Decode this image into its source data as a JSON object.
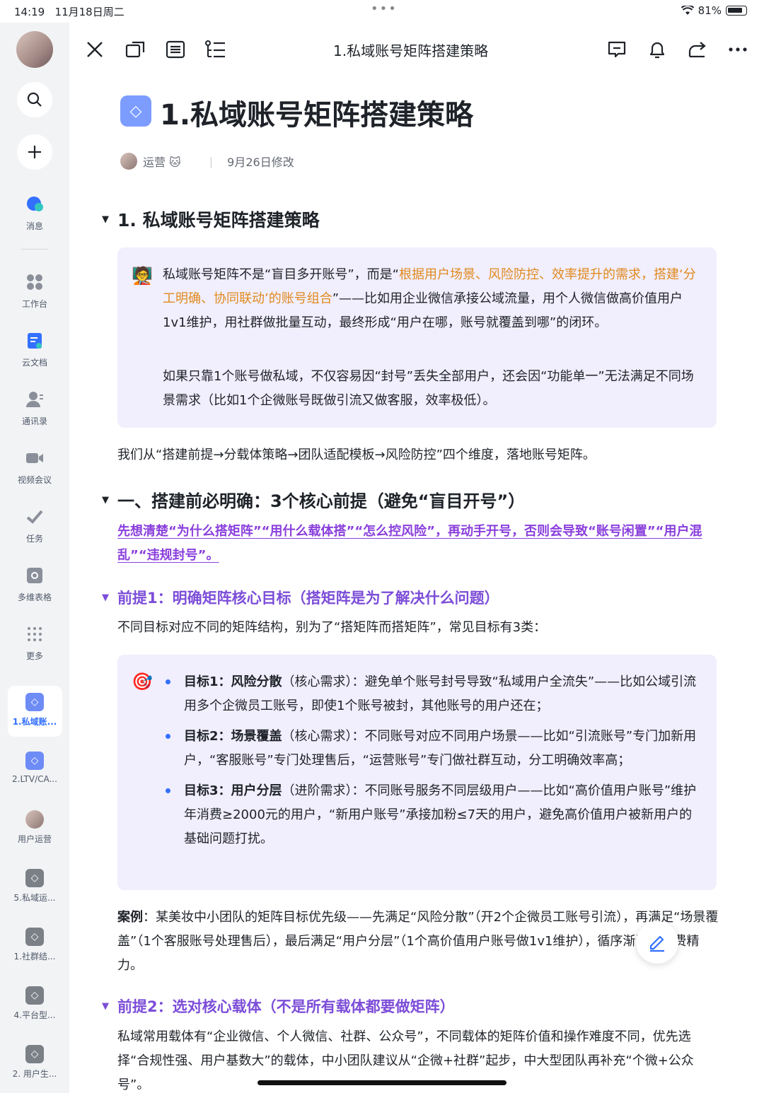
{
  "status": {
    "time": "14:19",
    "date": "11月18日周二",
    "battery": "81%"
  },
  "sidebar": {
    "items": [
      {
        "label": "消息",
        "icon": "chat-bubble-icon"
      },
      {
        "label": "工作台",
        "icon": "grid-icon"
      },
      {
        "label": "云文档",
        "icon": "document-icon"
      },
      {
        "label": "通讯录",
        "icon": "contacts-icon"
      },
      {
        "label": "视频会议",
        "icon": "video-camera-icon"
      },
      {
        "label": "任务",
        "icon": "checkmark-icon"
      },
      {
        "label": "多维表格",
        "icon": "table-icon"
      },
      {
        "label": "更多",
        "icon": "more-dots-icon"
      }
    ],
    "docs": [
      {
        "label": "1.私域账...",
        "active": true
      },
      {
        "label": "2.LTV/CA..."
      },
      {
        "label": "用户运营"
      },
      {
        "label": "5.私域运..."
      },
      {
        "label": "1.社群结..."
      },
      {
        "label": "4.平台型..."
      },
      {
        "label": "2. 用户生..."
      }
    ]
  },
  "toolbar": {
    "title": "1.私域账号矩阵搭建策略"
  },
  "doc": {
    "title": "1.私域账号矩阵搭建策略",
    "author": "运营 🐱",
    "modified": "9月26日修改",
    "h1": "1. 私域账号矩阵搭建策略",
    "callout1": {
      "emoji": "🧑‍🏫",
      "p1_a": "私域账号矩阵不是“盲目多开账号”，而是“",
      "p1_orange": "根据用户场景、风险防控、效率提升的需求，搭建‘分工明确、协同联动’的账号组合",
      "p1_b": "”——比如用企业微信承接公域流量，用个人微信做高价值用户1v1维护，用社群做批量互动，最终形成“用户在哪，账号就覆盖到哪”的闭环。",
      "p2": "如果只靠1个账号做私域，不仅容易因“封号”丢失全部用户，还会因“功能单一”无法满足不同场景需求（比如1个企微账号既做引流又做客服，效率极低）。"
    },
    "intro": "我们从“搭建前提→分载体策略→团队适配模板→风险防控”四个维度，落地账号矩阵。",
    "h1_2": "一、搭建前必明确：3个核心前提（避免“盲目开号”）",
    "purple_note": "先想清楚“为什么搭矩阵”“用什么载体搭”“怎么控风险”，再动手开号，否则会导致“账号闲置”“用户混乱”“违规封号”。",
    "h2_1": "前提1：明确矩阵核心目标（搭矩阵是为了解决什么问题）",
    "p_goal": "不同目标对应不同的矩阵结构，别为了“搭矩阵而搭矩阵”，常见目标有3类：",
    "callout2": {
      "emoji": "🎯",
      "items": [
        {
          "bold": "目标1：风险分散",
          "tag": "（核心需求）",
          "text": "：避免单个账号封号导致“私域用户全流失”——比如公域引流用多个企微员工账号，即使1个账号被封，其他账号的用户还在；"
        },
        {
          "bold": "目标2：场景覆盖",
          "tag": "（核心需求）",
          "text": "：不同账号对应不同用户场景——比如“引流账号”专门加新用户，“客服账号”专门处理售后，“运营账号”专门做社群互动，分工明确效率高；"
        },
        {
          "bold": "目标3：用户分层",
          "tag": "（进阶需求）",
          "text": "：不同账号服务不同层级用户——比如“高价值用户账号”维护年消费≥2000元的用户，“新用户账号”承接加粉≤7天的用户，避免高价值用户被新用户的基础问题打扰。"
        }
      ]
    },
    "case_label": "案例",
    "case_text": "：某美妆中小团队的矩阵目标优先级——先满足“风险分散”（开2个企微员工账号引流），再满足“场景覆盖”（1个客服账号处理售后），最后满足“用户分层”（1个高价值用户账号做1v1维护），循序渐进不浪费精力。",
    "h2_2": "前提2：选对核心载体（不是所有载体都要做矩阵）",
    "p_carrier": "私域常用载体有“企业微信、个人微信、社群、公众号”，不同载体的矩阵价值和操作难度不同，优先选择“合规性强、用户基数大”的载体，中小团队建议从“企微+社群”起步，中大型团队再补充“个微+公众号”。"
  },
  "colors": {
    "accent": "#3370ff",
    "heading_purple": "#7c4dd8",
    "orange": "#e08a1e",
    "callout_bg": "#f1eefd",
    "sidebar_bg": "#f2f3f5"
  }
}
